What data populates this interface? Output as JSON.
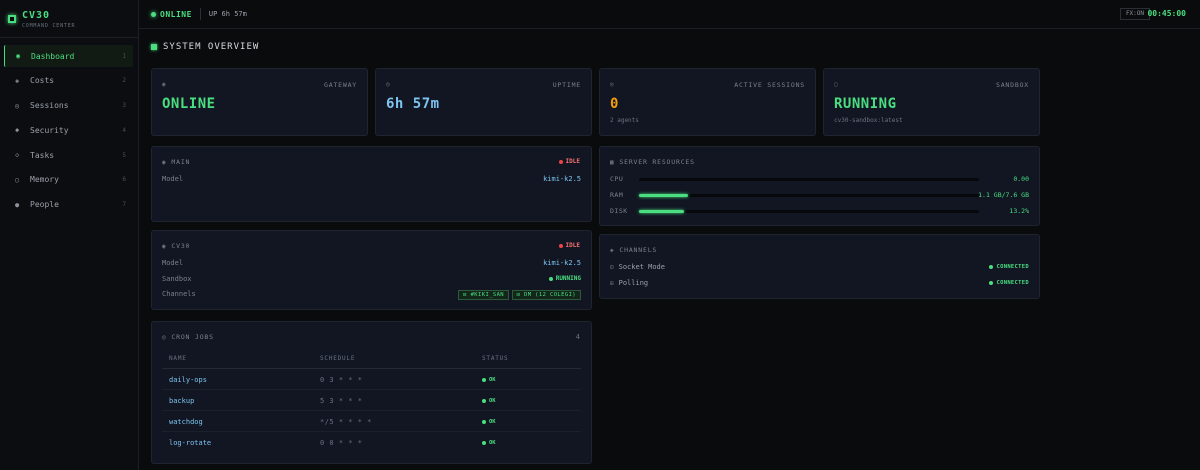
{
  "brand": {
    "title": "CV30",
    "subtitle": "COMMAND CENTER"
  },
  "sidebar": {
    "items": [
      {
        "icon": "◉",
        "label": "Dashboard",
        "num": "1"
      },
      {
        "icon": "◈",
        "label": "Costs",
        "num": "2"
      },
      {
        "icon": "◎",
        "label": "Sessions",
        "num": "3"
      },
      {
        "icon": "◆",
        "label": "Security",
        "num": "4"
      },
      {
        "icon": "◇",
        "label": "Tasks",
        "num": "5"
      },
      {
        "icon": "○",
        "label": "Memory",
        "num": "6"
      },
      {
        "icon": "●",
        "label": "People",
        "num": "7"
      }
    ]
  },
  "topbar": {
    "status": "ONLINE",
    "uptime": "UP 6h 57m",
    "fx": "FX:ON",
    "clock": "00:45:00"
  },
  "overview": {
    "title": "SYSTEM OVERVIEW"
  },
  "stats": [
    {
      "icon": "◉",
      "label": "GATEWAY",
      "value": "ONLINE",
      "sub": "",
      "color": "#4ade80"
    },
    {
      "icon": "◷",
      "label": "UPTIME",
      "value": "6h 57m",
      "sub": "",
      "color": "#7dc4f0"
    },
    {
      "icon": "◎",
      "label": "ACTIVE SESSIONS",
      "value": "0",
      "sub": "2 agents",
      "color": "#f59e0b"
    },
    {
      "icon": "▢",
      "label": "SANDBOX",
      "value": "RUNNING",
      "sub": "cv30-sandbox:latest",
      "color": "#4ade80"
    }
  ],
  "main_agent": {
    "icon": "◉",
    "title": "MAIN",
    "status": "IDLE",
    "model_label": "Model",
    "model": "kimi-k2.5"
  },
  "cv30_agent": {
    "icon": "◉",
    "title": "CV30",
    "status": "IDLE",
    "model_label": "Model",
    "model": "kimi-k2.5",
    "sandbox_label": "Sandbox",
    "sandbox": "RUNNING",
    "channels_label": "Channels",
    "channels": [
      "⊡ #KIKI_SAN",
      "⊡ DM (12 COLEGI)"
    ]
  },
  "cron": {
    "icon": "◷",
    "title": "CRON JOBS",
    "count": "4",
    "headers": [
      "NAME",
      "SCHEDULE",
      "STATUS"
    ],
    "rows": [
      {
        "name": "daily-ops",
        "schedule": "0 3 * * *",
        "status": "OK"
      },
      {
        "name": "backup",
        "schedule": "5 3 * * *",
        "status": "OK"
      },
      {
        "name": "watchdog",
        "schedule": "*/5 * * * *",
        "status": "OK"
      },
      {
        "name": "log-rotate",
        "schedule": "0 0 * * *",
        "status": "OK"
      }
    ]
  },
  "resources": {
    "icon": "▦",
    "title": "SERVER RESOURCES",
    "items": [
      {
        "label": "CPU",
        "value": "0.00",
        "fraction": 0.0
      },
      {
        "label": "RAM",
        "value": "1.1 GB/7.6 GB",
        "fraction": 0.145
      },
      {
        "label": "DISK",
        "value": "13.2%",
        "fraction": 0.132
      }
    ]
  },
  "channels": {
    "icon": "◈",
    "title": "CHANNELS",
    "items": [
      {
        "icon": "⊡",
        "label": "Socket Mode",
        "status": "CONNECTED"
      },
      {
        "icon": "⊞",
        "label": "Polling",
        "status": "CONNECTED"
      }
    ]
  }
}
